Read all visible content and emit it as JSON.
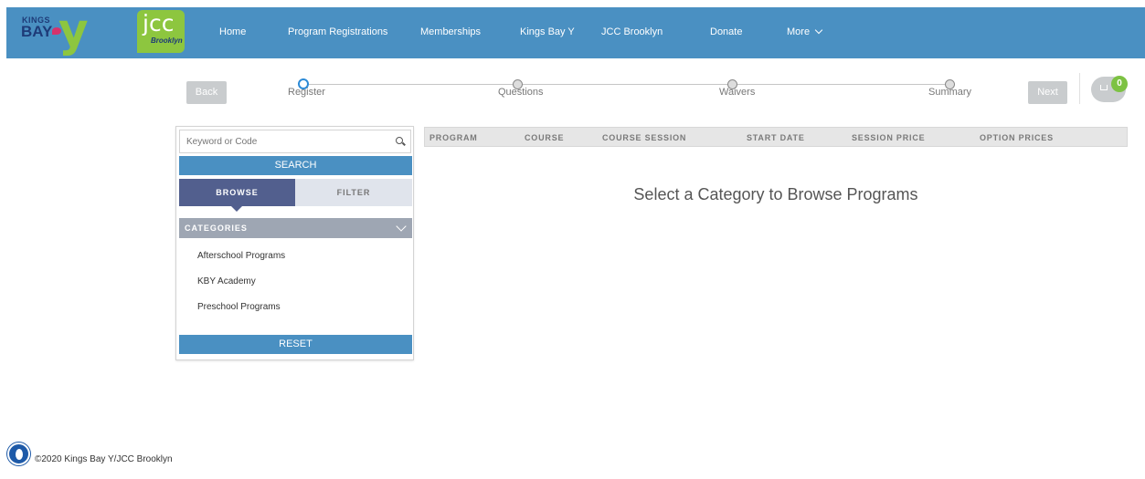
{
  "brand": {
    "kby_kings": "KINGS",
    "kby_bay": "BAY",
    "kby_y": "y",
    "jcc": "jcc",
    "jcc_sub": "Brooklyn"
  },
  "nav": {
    "items": [
      "Home",
      "Program Registrations",
      "Memberships",
      "Kings Bay Y",
      "JCC Brooklyn",
      "Donate"
    ],
    "more": "More"
  },
  "stepper": {
    "back": "Back",
    "next": "Next",
    "steps": [
      "Register",
      "Questions",
      "Waivers",
      "Summary"
    ],
    "active_index": 0
  },
  "cart": {
    "count": "0"
  },
  "panel": {
    "search_placeholder": "Keyword or Code",
    "search_button": "SEARCH",
    "tab_browse": "BROWSE",
    "tab_filter": "FILTER",
    "categories_label": "CATEGORIES",
    "categories": [
      "Afterschool Programs",
      "KBY Academy",
      "Preschool Programs"
    ],
    "reset_button": "RESET"
  },
  "table": {
    "headers": [
      "PROGRAM",
      "COURSE",
      "COURSE SESSION",
      "START DATE",
      "SESSION PRICE",
      "OPTION PRICES"
    ],
    "empty_message": "Select a Category to Browse Programs"
  },
  "footer": {
    "copyright": "©2020 Kings Bay Y/JCC Brooklyn"
  },
  "colors": {
    "header": "#4a90c2",
    "browse_tab": "#525f8e",
    "accent_green": "#8dc63f",
    "active_step": "#2c8ad6"
  }
}
